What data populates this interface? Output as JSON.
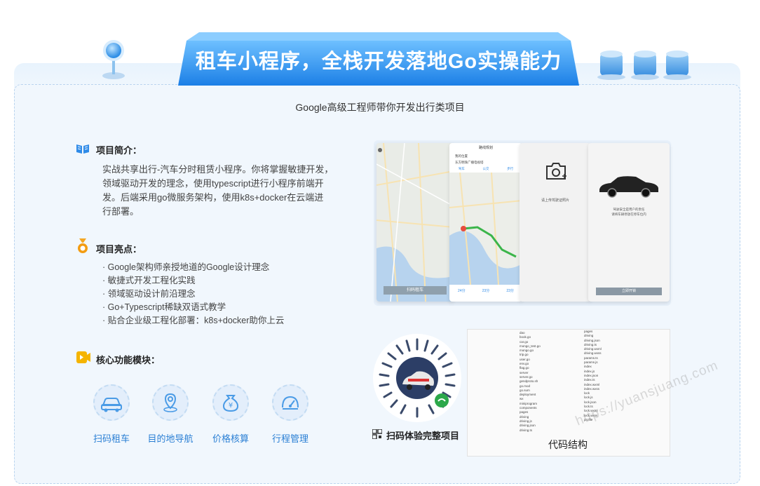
{
  "banner": {
    "title": "租车小程序，全栈开发落地Go实操能力",
    "subtitle": "Google高级工程师带你开发出行类项目"
  },
  "intro": {
    "heading": "项目简介：",
    "text": "实战共享出行-汽车分时租赁小程序。你将掌握敏捷开发，领域驱动开发的理念，使用typescript进行小程序前端开发。后端采用go微服务架构，使用k8s+docker在云端进行部署。",
    "lines": [
      "实战共享出行-汽车分时租赁小程序。你将掌握敏捷开发，",
      "领域驱动开发的理念，使用typescript进行小程序前端开",
      "发。后端采用go微服务架构，使用k8s+docker在云端进",
      "行部署。"
    ]
  },
  "highlights": {
    "heading": "项目亮点：",
    "items": [
      "· Google架构师亲授地道的Google设计理念",
      "· 敏捷式开发工程化实践",
      "· 领域驱动设计前沿理念",
      "· Go+Typescript稀缺双语式教学",
      "· 贴合企业级工程化部署：k8s+docker助你上云"
    ]
  },
  "modules": {
    "heading": "核心功能模块：",
    "items": [
      {
        "label": "扫码租车",
        "icon": "car-icon"
      },
      {
        "label": "目的地导航",
        "icon": "location-pin-icon"
      },
      {
        "label": "价格核算",
        "icon": "yen-bag-icon"
      },
      {
        "label": "行程管理",
        "icon": "speedometer-icon"
      }
    ]
  },
  "screens": {
    "s1_button": "扫码租车",
    "s2_title": "路线规划",
    "s2_from": "我的位置",
    "s2_to": "东方明珠广播电视塔",
    "s2_tabs": [
      "驾车",
      "公交",
      "步行"
    ],
    "s2_times": [
      "24分",
      "23分",
      "23分"
    ],
    "s3_caption": "请上传驾驶证照片",
    "s4_text1": "驾驶安全是用户的责任",
    "s4_text2": "请将车辆停放在停车位内",
    "s4_button": "立即开锁"
  },
  "qr": {
    "caption": "扫码体验完整项目",
    "icon": "qr-code-icon"
  },
  "code": {
    "caption": "代码结构",
    "left_tree": [
      "dao",
      "book.go",
      "car.go",
      "mongo_test.go",
      "mongo.go",
      "trip.go",
      "user.go",
      "env.go",
      "flag.go",
      "server",
      "server.go",
      "gendproto.sh",
      "go.mod",
      "go.sum",
      "deployment",
      "wx",
      "miniprogram",
      "components",
      "pages",
      "driving",
      "driving.js",
      "driving.json",
      "driving.ts"
    ],
    "right_tree": [
      "pages",
      "driving",
      "driving.json",
      "driving.ts",
      "driving.wxml",
      "driving.wxss",
      "params.ts",
      "params.js",
      "index",
      "index.js",
      "index.json",
      "index.ts",
      "index.wxml",
      "index.wxss",
      "lock",
      "lock.js",
      "lock.json",
      "lock.ts",
      "lock.wxml",
      "lock.wxss",
      "profile"
    ]
  },
  "watermark": "https://yuansjuang.com",
  "colors": {
    "accent": "#2f8be8",
    "banner": "#3a9bf0",
    "panel": "#f1f7fd",
    "link": "#2a7fd4"
  }
}
